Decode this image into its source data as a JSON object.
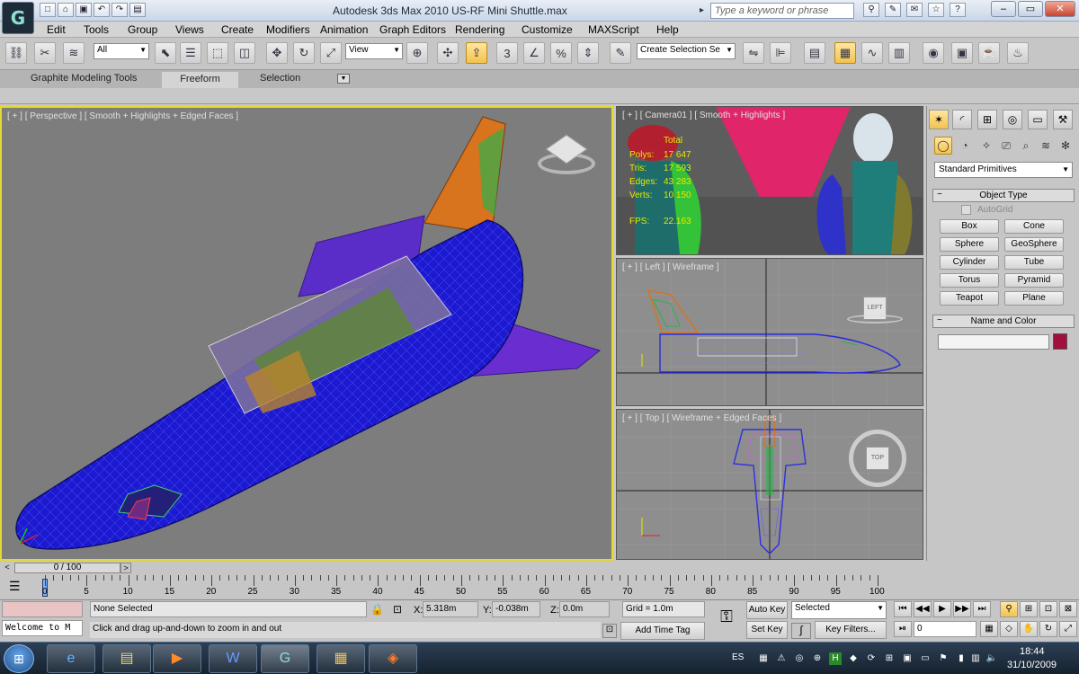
{
  "window": {
    "title": "Autodesk 3ds Max  2010      US-RF Mini Shuttle.max",
    "search_placeholder": "Type a keyword or phrase",
    "app_logo": "3ds-max-icon"
  },
  "menu": [
    "Edit",
    "Tools",
    "Group",
    "Views",
    "Create",
    "Modifiers",
    "Animation",
    "Graph Editors",
    "Rendering",
    "Customize",
    "MAXScript",
    "Help"
  ],
  "toolbar": {
    "filter_value": "All",
    "refcoord_value": "View",
    "snap_label": "3",
    "angle_label": "%",
    "selection_set_value": "Create Selection Se"
  },
  "ribbon": {
    "tabs": [
      "Graphite Modeling Tools",
      "Freeform",
      "Selection"
    ],
    "active": "Freeform"
  },
  "viewports": {
    "perspective_label": "[ + ] [ Perspective ] [ Smooth + Highlights + Edged Faces ]",
    "camera_label": "[ + ] [ Camera01 ] [ Smooth + Highlights ]",
    "left_label": "[ + ] [ Left ] [ Wireframe ]",
    "top_label": "[ + ] [ Top ] [ Wireframe + Edged Faces ]",
    "viewcube_left": "LEFT",
    "viewcube_top": "TOP",
    "stats": {
      "total_header": "Total",
      "polys_label": "Polys:",
      "polys": "17 647",
      "tris_label": "Tris:",
      "tris": "17 593",
      "edges_label": "Edges:",
      "edges": "43 283",
      "verts_label": "Verts:",
      "verts": "10 150",
      "fps_label": "FPS:",
      "fps": "22.163"
    }
  },
  "command_panel": {
    "primitive_type": "Standard Primitives",
    "object_type_header": "Object Type",
    "autogrid_label": "AutoGrid",
    "buttons": [
      "Box",
      "Cone",
      "Sphere",
      "GeoSphere",
      "Cylinder",
      "Tube",
      "Torus",
      "Pyramid",
      "Teapot",
      "Plane"
    ],
    "name_color_header": "Name and Color",
    "object_name": "",
    "object_color": "#a0103a"
  },
  "timeline": {
    "frame_display": "0 / 100",
    "ticks": [
      "0",
      "5",
      "10",
      "15",
      "20",
      "25",
      "30",
      "35",
      "40",
      "45",
      "50",
      "55",
      "60",
      "65",
      "70",
      "75",
      "80",
      "85",
      "90",
      "95",
      "100"
    ]
  },
  "status": {
    "maxscript_listener": "Welcome to M",
    "selection_status": "None Selected",
    "prompt": "Click and drag up-and-down to zoom in and out",
    "x_label": "X:",
    "x_value": "5.318m",
    "y_label": "Y:",
    "y_value": "-0.038m",
    "z_label": "Z:",
    "z_value": "0.0m",
    "grid": "Grid = 1.0m",
    "add_time_tag": "Add Time Tag",
    "auto_key": "Auto Key",
    "set_key": "Set Key",
    "key_mode_value": "Selected",
    "key_filters": "Key Filters...",
    "current_frame": "0"
  },
  "taskbar": {
    "language": "ES",
    "time": "18:44",
    "date": "31/10/2009"
  }
}
